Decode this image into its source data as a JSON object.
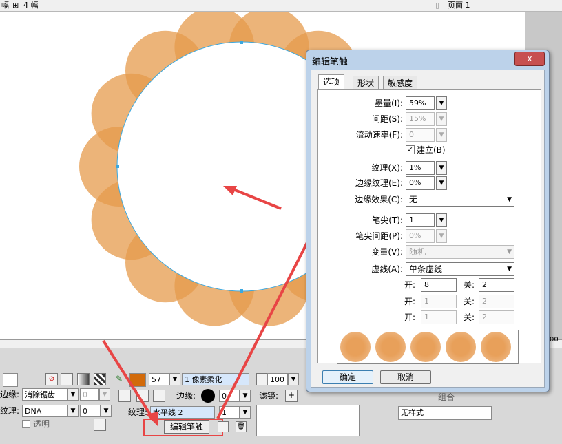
{
  "topbar": {
    "left_text": "幅",
    "frames_label": "4 幅",
    "page_label": "页面 1"
  },
  "dialog": {
    "title": "编辑笔触",
    "close": "x",
    "tabs": [
      "选项",
      "形状",
      "敏感度"
    ],
    "ink_amount": {
      "label": "墨量(I):",
      "value": "59%"
    },
    "spacing": {
      "label": "间距(S):",
      "value": "15%"
    },
    "flow_rate": {
      "label": "流动速率(F):",
      "value": "0"
    },
    "build_up": {
      "label": "建立(B)",
      "checked": true
    },
    "texture": {
      "label": "纹理(X):",
      "value": "1%"
    },
    "edge_texture": {
      "label": "边缘纹理(E):",
      "value": "0%"
    },
    "edge_effect": {
      "label": "边缘效果(C):",
      "value": "无"
    },
    "tips": {
      "label": "笔尖(T):",
      "value": "1"
    },
    "tip_spacing": {
      "label": "笔尖间距(P):",
      "value": "0%"
    },
    "variation": {
      "label": "变量(V):",
      "value": "随机"
    },
    "dash": {
      "label": "虚线(A):",
      "value": "单条虚线"
    },
    "dash_rows": [
      {
        "on_label": "开:",
        "on": "8",
        "off_label": "关:",
        "off": "2"
      },
      {
        "on_label": "开:",
        "on": "1",
        "off_label": "关:",
        "off": "2"
      },
      {
        "on_label": "开:",
        "on": "1",
        "off_label": "关:",
        "off": "2"
      }
    ],
    "ok": "确定",
    "cancel": "取消"
  },
  "props": {
    "edge_label": "边缘:",
    "edge_value": "消除锯齿",
    "edge_num": "0",
    "texture_label": "纹理:",
    "texture_value": "DNA",
    "texture_num": "0",
    "transparent_label": "透明",
    "stroke_size": "57",
    "stroke_type": "1 像素柔化",
    "stroke_edge_label": "边缘:",
    "stroke_edge_value": "0",
    "stroke_texture_label": "纹理:",
    "stroke_texture_value": "水平线 2",
    "stroke_texture_num": "1",
    "edit_stroke_button": "编辑笔触",
    "opacity": "100",
    "filters_label": "滤镜:",
    "group_label": "组合",
    "style_value": "无样式",
    "ruler_fragment": "00"
  },
  "colors": {
    "stroke_color": "#d26a0a",
    "petal": "#e2892e",
    "arrow": "#e84545",
    "selection": "#3aa8e0"
  }
}
